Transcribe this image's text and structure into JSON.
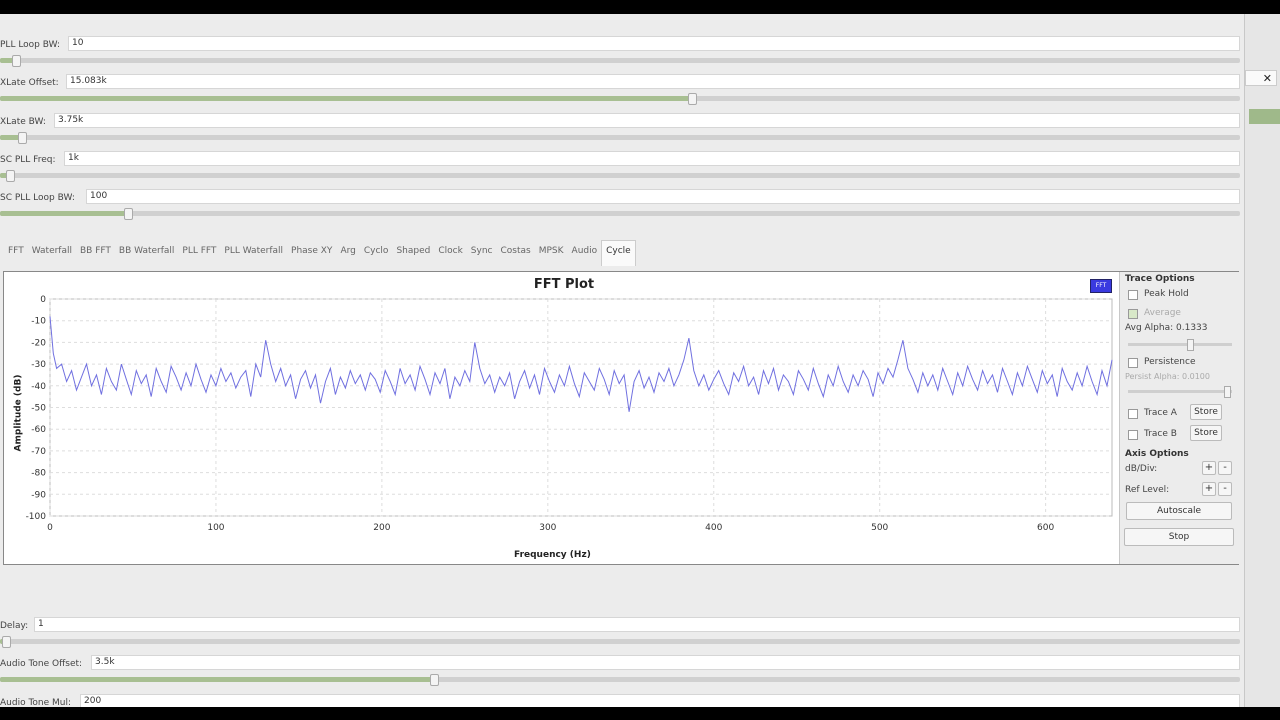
{
  "controls_top": [
    {
      "label": "PLL Loop BW:",
      "value": "10",
      "level": 0.013
    },
    {
      "label": "XLate Offset:",
      "value": "15.083k",
      "level": 0.558
    },
    {
      "label": "XLate BW:",
      "value": "3.75k",
      "level": 0.018
    },
    {
      "label": "SC PLL Freq:",
      "value": "1k",
      "level": 0.008
    },
    {
      "label": "SC PLL Loop BW:",
      "value": "100",
      "level": 0.103
    }
  ],
  "tabs": [
    "FFT",
    "Waterfall",
    "BB FFT",
    "BB Waterfall",
    "PLL FFT",
    "PLL Waterfall",
    "Phase XY",
    "Arg",
    "Cyclo",
    "Shaped",
    "Clock",
    "Sync",
    "Costas",
    "MPSK",
    "Audio",
    "Cycle"
  ],
  "active_tab": "Cycle",
  "plot": {
    "legend_label": "FFT"
  },
  "trace_options": {
    "title": "Trace Options",
    "peak_hold": "Peak Hold",
    "average": "Average",
    "avg_alpha_label": "Avg Alpha: 0.1333",
    "avg_alpha_level": 0.6,
    "persistence": "Persistence",
    "persist_alpha_label": "Persist Alpha: 0.0100",
    "trace_a": "Trace A",
    "trace_b": "Trace B",
    "store": "Store",
    "axis_title": "Axis Options",
    "db_div": "dB/Div:",
    "ref_level": "Ref Level:",
    "plus": "+",
    "minus": "-",
    "autoscale": "Autoscale",
    "stop": "Stop"
  },
  "controls_bottom": [
    {
      "label": "Delay:",
      "value": "1",
      "level": 0.005
    },
    {
      "label": "Audio Tone Offset:",
      "value": "3.5k",
      "level": 0.35
    },
    {
      "label": "Audio Tone Mul:",
      "value": "200",
      "level": 0.0
    }
  ],
  "chart_data": {
    "type": "line",
    "title": "FFT Plot",
    "xlabel": "Frequency (Hz)",
    "ylabel": "Amplitude (dB)",
    "xlim": [
      0,
      640
    ],
    "ylim": [
      -100,
      0
    ],
    "xticks": [
      "0",
      "100",
      "200",
      "300",
      "400",
      "500",
      "600"
    ],
    "yticks": [
      "0",
      "-10",
      "-20",
      "-30",
      "-40",
      "-50",
      "-60",
      "-70",
      "-80",
      "-90",
      "-100"
    ],
    "grid": true,
    "legend": "top-right",
    "series": [
      {
        "name": "FFT",
        "color": "#7070e0",
        "points": [
          [
            0,
            -8
          ],
          [
            2,
            -25
          ],
          [
            4,
            -32
          ],
          [
            7,
            -30
          ],
          [
            10,
            -38
          ],
          [
            13,
            -33
          ],
          [
            16,
            -42
          ],
          [
            19,
            -36
          ],
          [
            22,
            -30
          ],
          [
            25,
            -40
          ],
          [
            28,
            -35
          ],
          [
            31,
            -44
          ],
          [
            34,
            -32
          ],
          [
            37,
            -38
          ],
          [
            40,
            -42
          ],
          [
            43,
            -30
          ],
          [
            46,
            -37
          ],
          [
            49,
            -44
          ],
          [
            52,
            -33
          ],
          [
            55,
            -39
          ],
          [
            58,
            -35
          ],
          [
            61,
            -45
          ],
          [
            64,
            -32
          ],
          [
            67,
            -38
          ],
          [
            70,
            -43
          ],
          [
            73,
            -31
          ],
          [
            76,
            -36
          ],
          [
            79,
            -42
          ],
          [
            82,
            -34
          ],
          [
            85,
            -40
          ],
          [
            88,
            -30
          ],
          [
            91,
            -37
          ],
          [
            94,
            -43
          ],
          [
            97,
            -35
          ],
          [
            100,
            -40
          ],
          [
            103,
            -32
          ],
          [
            106,
            -38
          ],
          [
            109,
            -34
          ],
          [
            112,
            -41
          ],
          [
            115,
            -36
          ],
          [
            118,
            -33
          ],
          [
            121,
            -45
          ],
          [
            124,
            -30
          ],
          [
            127,
            -36
          ],
          [
            130,
            -19
          ],
          [
            133,
            -30
          ],
          [
            136,
            -38
          ],
          [
            139,
            -32
          ],
          [
            142,
            -40
          ],
          [
            145,
            -35
          ],
          [
            148,
            -46
          ],
          [
            151,
            -37
          ],
          [
            154,
            -33
          ],
          [
            157,
            -41
          ],
          [
            160,
            -35
          ],
          [
            163,
            -48
          ],
          [
            166,
            -38
          ],
          [
            169,
            -32
          ],
          [
            172,
            -44
          ],
          [
            175,
            -36
          ],
          [
            178,
            -41
          ],
          [
            181,
            -33
          ],
          [
            184,
            -39
          ],
          [
            187,
            -35
          ],
          [
            190,
            -42
          ],
          [
            193,
            -34
          ],
          [
            196,
            -37
          ],
          [
            199,
            -43
          ],
          [
            202,
            -33
          ],
          [
            205,
            -38
          ],
          [
            208,
            -44
          ],
          [
            211,
            -32
          ],
          [
            214,
            -39
          ],
          [
            217,
            -35
          ],
          [
            220,
            -42
          ],
          [
            223,
            -31
          ],
          [
            226,
            -37
          ],
          [
            229,
            -44
          ],
          [
            232,
            -34
          ],
          [
            235,
            -39
          ],
          [
            238,
            -32
          ],
          [
            241,
            -46
          ],
          [
            244,
            -36
          ],
          [
            247,
            -40
          ],
          [
            250,
            -33
          ],
          [
            253,
            -38
          ],
          [
            256,
            -20
          ],
          [
            259,
            -32
          ],
          [
            262,
            -39
          ],
          [
            265,
            -35
          ],
          [
            268,
            -43
          ],
          [
            271,
            -36
          ],
          [
            274,
            -40
          ],
          [
            277,
            -34
          ],
          [
            280,
            -46
          ],
          [
            283,
            -38
          ],
          [
            286,
            -33
          ],
          [
            289,
            -41
          ],
          [
            292,
            -35
          ],
          [
            295,
            -44
          ],
          [
            298,
            -32
          ],
          [
            301,
            -38
          ],
          [
            304,
            -43
          ],
          [
            307,
            -35
          ],
          [
            310,
            -40
          ],
          [
            313,
            -31
          ],
          [
            316,
            -39
          ],
          [
            319,
            -45
          ],
          [
            322,
            -34
          ],
          [
            325,
            -38
          ],
          [
            328,
            -42
          ],
          [
            331,
            -32
          ],
          [
            334,
            -37
          ],
          [
            337,
            -44
          ],
          [
            340,
            -33
          ],
          [
            343,
            -39
          ],
          [
            346,
            -35
          ],
          [
            349,
            -52
          ],
          [
            352,
            -38
          ],
          [
            355,
            -33
          ],
          [
            358,
            -41
          ],
          [
            361,
            -36
          ],
          [
            364,
            -43
          ],
          [
            367,
            -34
          ],
          [
            370,
            -38
          ],
          [
            373,
            -32
          ],
          [
            376,
            -40
          ],
          [
            379,
            -35
          ],
          [
            382,
            -28
          ],
          [
            385,
            -18
          ],
          [
            388,
            -33
          ],
          [
            391,
            -40
          ],
          [
            394,
            -35
          ],
          [
            397,
            -42
          ],
          [
            400,
            -37
          ],
          [
            403,
            -33
          ],
          [
            406,
            -39
          ],
          [
            409,
            -44
          ],
          [
            412,
            -34
          ],
          [
            415,
            -38
          ],
          [
            418,
            -31
          ],
          [
            421,
            -40
          ],
          [
            424,
            -36
          ],
          [
            427,
            -44
          ],
          [
            430,
            -33
          ],
          [
            433,
            -39
          ],
          [
            436,
            -32
          ],
          [
            439,
            -42
          ],
          [
            442,
            -35
          ],
          [
            445,
            -38
          ],
          [
            448,
            -44
          ],
          [
            451,
            -33
          ],
          [
            454,
            -37
          ],
          [
            457,
            -42
          ],
          [
            460,
            -32
          ],
          [
            463,
            -39
          ],
          [
            466,
            -45
          ],
          [
            469,
            -35
          ],
          [
            472,
            -40
          ],
          [
            475,
            -31
          ],
          [
            478,
            -38
          ],
          [
            481,
            -43
          ],
          [
            484,
            -35
          ],
          [
            487,
            -40
          ],
          [
            490,
            -33
          ],
          [
            493,
            -37
          ],
          [
            496,
            -45
          ],
          [
            499,
            -34
          ],
          [
            502,
            -39
          ],
          [
            505,
            -32
          ],
          [
            508,
            -36
          ],
          [
            511,
            -28
          ],
          [
            514,
            -19
          ],
          [
            517,
            -32
          ],
          [
            520,
            -37
          ],
          [
            523,
            -43
          ],
          [
            526,
            -34
          ],
          [
            529,
            -40
          ],
          [
            532,
            -35
          ],
          [
            535,
            -42
          ],
          [
            538,
            -32
          ],
          [
            541,
            -38
          ],
          [
            544,
            -44
          ],
          [
            547,
            -34
          ],
          [
            550,
            -40
          ],
          [
            553,
            -31
          ],
          [
            556,
            -37
          ],
          [
            559,
            -42
          ],
          [
            562,
            -33
          ],
          [
            565,
            -39
          ],
          [
            568,
            -35
          ],
          [
            571,
            -43
          ],
          [
            574,
            -32
          ],
          [
            577,
            -38
          ],
          [
            580,
            -44
          ],
          [
            583,
            -34
          ],
          [
            586,
            -40
          ],
          [
            589,
            -31
          ],
          [
            592,
            -37
          ],
          [
            595,
            -43
          ],
          [
            598,
            -33
          ],
          [
            601,
            -39
          ],
          [
            604,
            -35
          ],
          [
            607,
            -45
          ],
          [
            610,
            -32
          ],
          [
            613,
            -38
          ],
          [
            616,
            -42
          ],
          [
            619,
            -34
          ],
          [
            622,
            -40
          ],
          [
            625,
            -31
          ],
          [
            628,
            -38
          ],
          [
            631,
            -44
          ],
          [
            634,
            -33
          ],
          [
            637,
            -40
          ],
          [
            640,
            -28
          ]
        ]
      }
    ]
  }
}
